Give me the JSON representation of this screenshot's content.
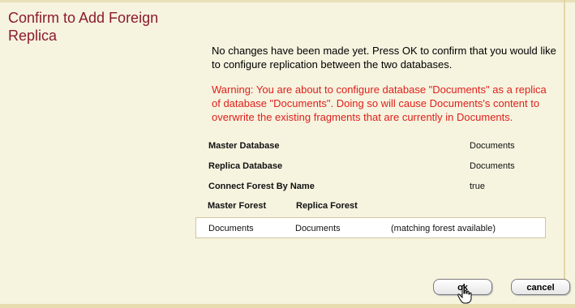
{
  "dialog": {
    "title": "Confirm to Add Foreign Replica",
    "message": [
      "No changes have been made yet. Press OK to confirm that you would like",
      "to configure replication between the two databases."
    ],
    "warning": [
      "Warning: You are about to configure database \"Documents\" as a replica",
      "of database \"Documents\". Doing so will cause Documents's content to",
      "overwrite the existing fragments that are currently in Documents."
    ]
  },
  "details": {
    "master_database": {
      "label": "Master Database",
      "value": "Documents"
    },
    "replica_database": {
      "label": "Replica Database",
      "value": "Documents"
    },
    "connect_forest_by_name": {
      "label": "Connect Forest By Name",
      "value": "true"
    }
  },
  "forests": {
    "headers": {
      "master": "Master Forest",
      "replica": "Replica Forest"
    },
    "rows": [
      {
        "master": "Documents",
        "replica": "Documents",
        "status": "(matching forest available)"
      }
    ]
  },
  "buttons": {
    "ok": "ok",
    "cancel": "cancel"
  },
  "colors": {
    "background": "#f6f3df",
    "title": "#8b1b2e",
    "warning": "#e0201b"
  },
  "icons": {
    "cursor": "hand-pointer-icon"
  }
}
